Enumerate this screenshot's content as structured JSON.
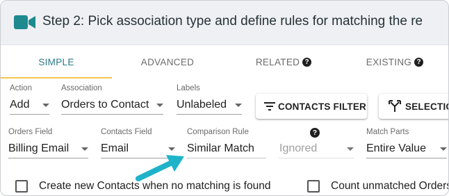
{
  "header": {
    "title": "Step 2: Pick association type and define rules for matching the re",
    "icon": "video-camera-icon"
  },
  "tabs": [
    {
      "label": "SIMPLE",
      "active": true
    },
    {
      "label": "ADVANCED",
      "active": false
    },
    {
      "label": "RELATED",
      "active": false,
      "help": "?"
    },
    {
      "label": "EXISTING",
      "active": false,
      "help": "?"
    }
  ],
  "row1": {
    "action": {
      "label": "Action",
      "value": "Add"
    },
    "association": {
      "label": "Association",
      "value": "Orders to Contact"
    },
    "labels": {
      "label": "Labels",
      "value": "Unlabeled"
    },
    "contacts_filter_label": "CONTACTS FILTER",
    "selection_label": "SELECTIO"
  },
  "row2": {
    "orders_field": {
      "label": "Orders Field",
      "value": "Billing Email"
    },
    "contacts_field": {
      "label": "Contacts Field",
      "value": "Email"
    },
    "comparison_rule": {
      "label": "Comparison Rule",
      "value": "Similar Match"
    },
    "ignored": {
      "value": "Ignored",
      "help": "?"
    },
    "match_parts": {
      "label": "Match Parts",
      "value": "Entire Value"
    }
  },
  "checkboxes": {
    "create_new": "Create new Contacts when no matching is found",
    "count_unmatched": "Count unmatched Orders"
  },
  "colors": {
    "accent": "#2b7a86",
    "tab_underline": "#f2c94c",
    "arrow": "#1fb3c9",
    "camera": "#1e8a8f"
  }
}
